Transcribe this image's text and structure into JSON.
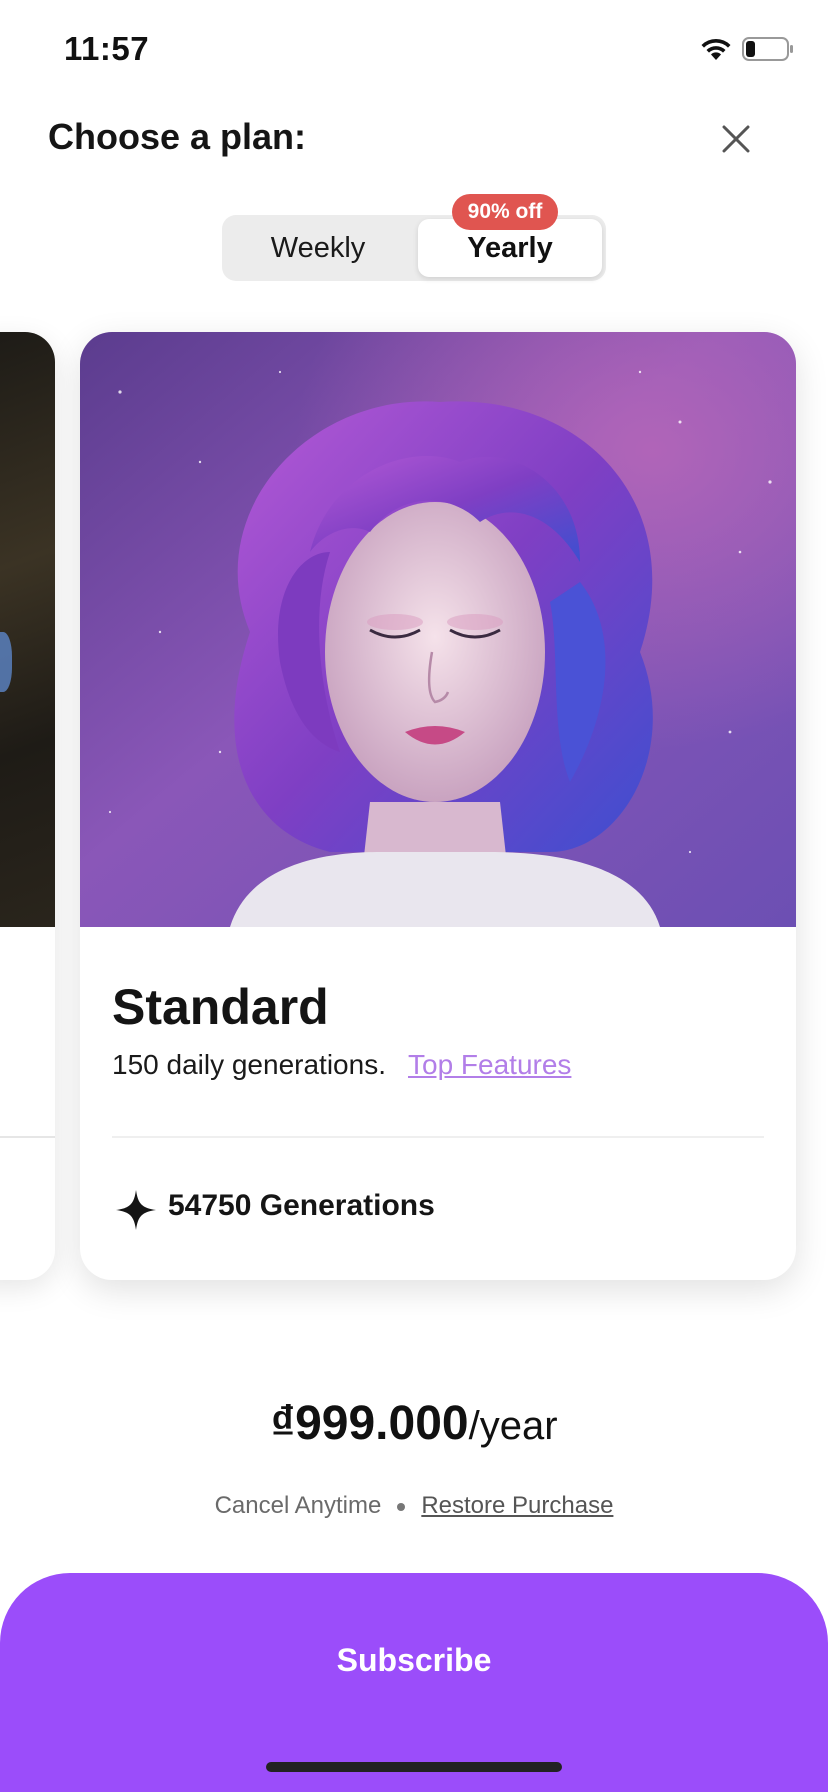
{
  "status_bar": {
    "time": "11:57",
    "wifi_icon": "wifi-icon",
    "battery_icon": "battery-icon",
    "battery_level": 0.2
  },
  "header": {
    "title": "Choose a plan:",
    "close_icon": "close-icon"
  },
  "plan_toggle": {
    "options": [
      "Weekly",
      "Yearly"
    ],
    "selected": "Yearly",
    "badge": "90% off"
  },
  "plan_card": {
    "name": "Standard",
    "description": "150 daily generations.",
    "link_label": "Top Features",
    "feature_icon": "sparkle-icon",
    "feature_text": "54750 Generations",
    "link_color": "#b27ee8"
  },
  "pricing": {
    "amount": "₫999.000",
    "period": "/year",
    "cancel_text": "Cancel Anytime",
    "restore_label": "Restore Purchase"
  },
  "cta": {
    "label": "Subscribe",
    "color": "#9b4dfa"
  }
}
